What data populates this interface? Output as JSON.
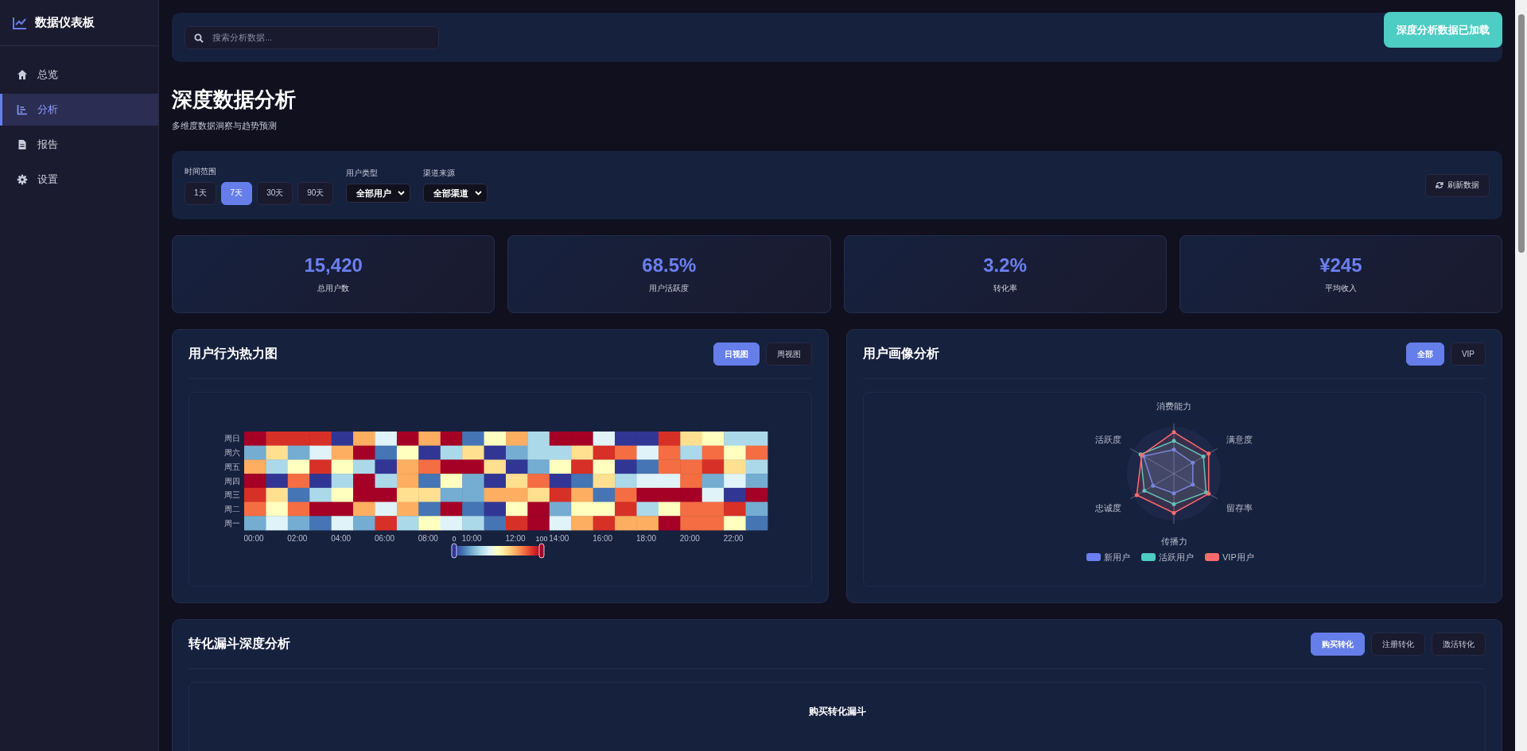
{
  "sidebar": {
    "logo": "数据仪表板",
    "items": [
      {
        "label": "总览",
        "selected": false
      },
      {
        "label": "分析",
        "selected": true
      },
      {
        "label": "报告",
        "selected": false
      },
      {
        "label": "设置",
        "selected": false
      }
    ]
  },
  "topbar": {
    "search": {
      "placeholder": "搜索分析数据..."
    },
    "notice": "深度分析数据已加载"
  },
  "page": {
    "title": "深度数据分析",
    "subtitle": "多维度数据洞察与趋势预测"
  },
  "filters": {
    "time_range": {
      "label": "时间范围",
      "options": [
        {
          "label": "1天",
          "selected": false
        },
        {
          "label": "7天",
          "selected": true
        },
        {
          "label": "30天",
          "selected": false
        },
        {
          "label": "90天",
          "selected": false
        }
      ]
    },
    "selects": [
      {
        "label": "用户类型",
        "value": "全部用户"
      },
      {
        "label": "渠道来源",
        "value": "全部渠道"
      }
    ],
    "refresh": "刷新数据"
  },
  "stats": [
    {
      "value": "15,420",
      "label": "总用户数"
    },
    {
      "value": "68.5%",
      "label": "用户活跃度"
    },
    {
      "value": "3.2%",
      "label": "转化率"
    },
    {
      "value": "¥245",
      "label": "平均收入"
    }
  ],
  "heatmap_panel": {
    "title": "用户行为热力图",
    "tabs": [
      {
        "label": "日视图",
        "selected": true
      },
      {
        "label": "周视图",
        "selected": false
      }
    ],
    "y_labels": [
      "周日",
      "周六",
      "周五",
      "周四",
      "周三",
      "周二",
      "周一"
    ],
    "x_labels": [
      "00:00",
      "02:00",
      "04:00",
      "06:00",
      "08:00",
      "10:00",
      "12:00",
      "14:00",
      "16:00",
      "18:00",
      "20:00",
      "22:00"
    ],
    "scale_min": "0",
    "scale_max": "100"
  },
  "radar_panel": {
    "title": "用户画像分析",
    "tabs": [
      {
        "label": "全部",
        "selected": true
      },
      {
        "label": "VIP",
        "selected": false
      }
    ],
    "axes": [
      "消费能力",
      "满意度",
      "留存率",
      "传播力",
      "忠诚度",
      "活跃度"
    ],
    "legend": [
      {
        "label": "新用户",
        "color": "#6b7ff0"
      },
      {
        "label": "活跃用户",
        "color": "#4ecdc4"
      },
      {
        "label": "VIP用户",
        "color": "#ff6b6b"
      }
    ]
  },
  "funnel_panel": {
    "title": "转化漏斗深度分析",
    "tabs": [
      {
        "label": "购买转化",
        "selected": true
      },
      {
        "label": "注册转化",
        "selected": false
      },
      {
        "label": "激活转化",
        "selected": false
      }
    ],
    "chart_title": "购买转化漏斗"
  }
}
